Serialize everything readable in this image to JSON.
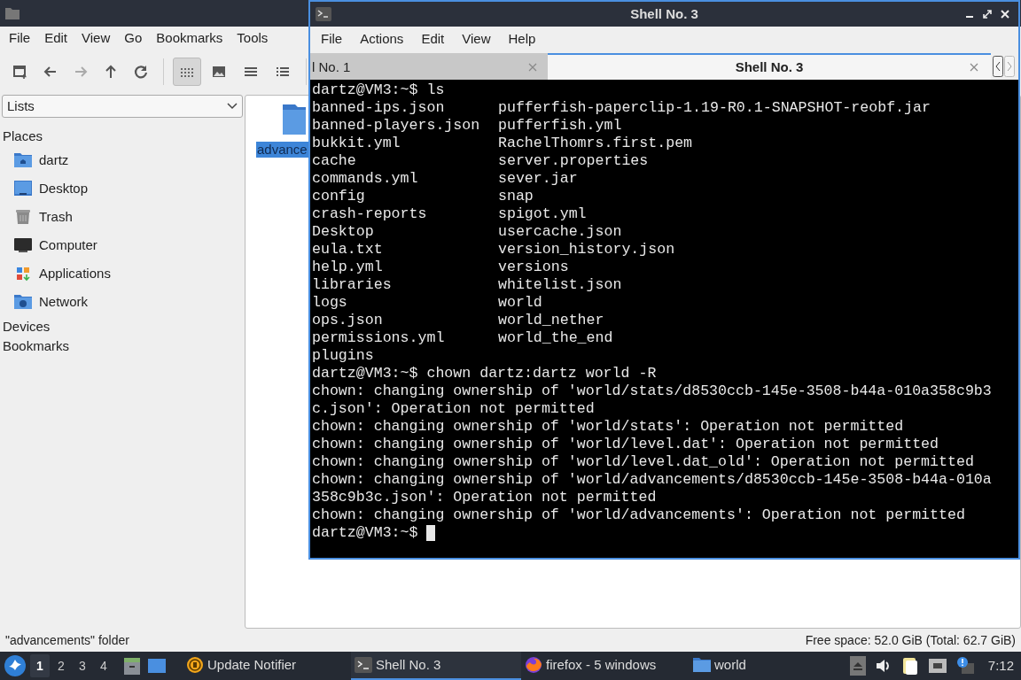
{
  "file_manager": {
    "menu": [
      "File",
      "Edit",
      "View",
      "Go",
      "Bookmarks",
      "Tools"
    ],
    "nav_buttons": [
      {
        "kind": "new_window",
        "disabled": false
      },
      {
        "kind": "back",
        "disabled": false
      },
      {
        "kind": "forward",
        "disabled": true
      },
      {
        "kind": "up",
        "disabled": false
      },
      {
        "kind": "reload",
        "disabled": false
      }
    ],
    "view_modes": [
      {
        "kind": "icons",
        "selected": true
      },
      {
        "kind": "thumbnails",
        "selected": false
      },
      {
        "kind": "compact",
        "selected": false
      },
      {
        "kind": "details",
        "selected": false
      }
    ],
    "side_pane_mode": "Lists",
    "places_heading": "Places",
    "places": [
      {
        "label": "dartz",
        "kind": "home"
      },
      {
        "label": "Desktop",
        "kind": "desktop"
      },
      {
        "label": "Trash",
        "kind": "trash"
      },
      {
        "label": "Computer",
        "kind": "computer"
      },
      {
        "label": "Applications",
        "kind": "applications"
      },
      {
        "label": "Network",
        "kind": "network"
      }
    ],
    "devices_heading": "Devices",
    "bookmarks_heading": "Bookmarks",
    "items": [
      {
        "label": "advance",
        "selected": true
      }
    ],
    "status_left": "\"advancements\" folder",
    "status_right": "Free space: 52.0 GiB (Total: 62.7 GiB)"
  },
  "terminal": {
    "title": "Shell No. 3",
    "menu": [
      "File",
      "Actions",
      "Edit",
      "View",
      "Help"
    ],
    "tabs": [
      {
        "label": "l No. 1",
        "selected": false
      },
      {
        "label": "Shell No. 3",
        "selected": true
      }
    ],
    "lines": [
      {
        "kind": "text",
        "text": "dartz@VM3:~$ ls"
      },
      {
        "kind": "columns",
        "cols": [
          "banned-ips.json",
          "pufferfish-paperclip-1.19-R0.1-SNAPSHOT-reobf.jar"
        ]
      },
      {
        "kind": "columns",
        "cols": [
          "banned-players.json",
          "pufferfish.yml"
        ]
      },
      {
        "kind": "columns",
        "cols": [
          "bukkit.yml",
          "RachelThomrs.first.pem"
        ]
      },
      {
        "kind": "columns",
        "cols": [
          "cache",
          "server.properties"
        ]
      },
      {
        "kind": "columns",
        "cols": [
          "commands.yml",
          "sever.jar"
        ]
      },
      {
        "kind": "columns",
        "cols": [
          "config",
          "snap"
        ]
      },
      {
        "kind": "columns",
        "cols": [
          "crash-reports",
          "spigot.yml"
        ]
      },
      {
        "kind": "columns",
        "cols": [
          "Desktop",
          "usercache.json"
        ]
      },
      {
        "kind": "columns",
        "cols": [
          "eula.txt",
          "version_history.json"
        ]
      },
      {
        "kind": "columns",
        "cols": [
          "help.yml",
          "versions"
        ]
      },
      {
        "kind": "columns",
        "cols": [
          "libraries",
          "whitelist.json"
        ]
      },
      {
        "kind": "columns",
        "cols": [
          "logs",
          "world"
        ]
      },
      {
        "kind": "columns",
        "cols": [
          "ops.json",
          "world_nether"
        ]
      },
      {
        "kind": "columns",
        "cols": [
          "permissions.yml",
          "world_the_end"
        ]
      },
      {
        "kind": "text",
        "text": "plugins"
      },
      {
        "kind": "text",
        "text": "dartz@VM3:~$ chown dartz:dartz world -R"
      },
      {
        "kind": "text",
        "text": "chown: changing ownership of 'world/stats/d8530ccb-145e-3508-b44a-010a358c9b3"
      },
      {
        "kind": "text",
        "text": "c.json': Operation not permitted"
      },
      {
        "kind": "text",
        "text": "chown: changing ownership of 'world/stats': Operation not permitted"
      },
      {
        "kind": "text",
        "text": "chown: changing ownership of 'world/level.dat': Operation not permitted"
      },
      {
        "kind": "text",
        "text": "chown: changing ownership of 'world/level.dat_old': Operation not permitted"
      },
      {
        "kind": "text",
        "text": "chown: changing ownership of 'world/advancements/d8530ccb-145e-3508-b44a-010a"
      },
      {
        "kind": "text",
        "text": "358c9b3c.json': Operation not permitted"
      },
      {
        "kind": "text",
        "text": "chown: changing ownership of 'world/advancements': Operation not permitted"
      },
      {
        "kind": "prompt",
        "text": "dartz@VM3:~$ "
      }
    ]
  },
  "taskbar": {
    "workspaces": [
      {
        "label": "1",
        "selected": true
      },
      {
        "label": "2",
        "selected": false
      },
      {
        "label": "3",
        "selected": false
      },
      {
        "label": "4",
        "selected": false
      }
    ],
    "tasks": [
      {
        "label": "Update Notifier",
        "kind": "updater",
        "selected": false
      },
      {
        "label": "Shell No. 3",
        "kind": "terminal",
        "selected": true
      },
      {
        "label": "firefox - 5 windows",
        "kind": "browser",
        "selected": false
      },
      {
        "label": "world",
        "kind": "folder",
        "selected": false
      }
    ],
    "clock": "7:12"
  }
}
